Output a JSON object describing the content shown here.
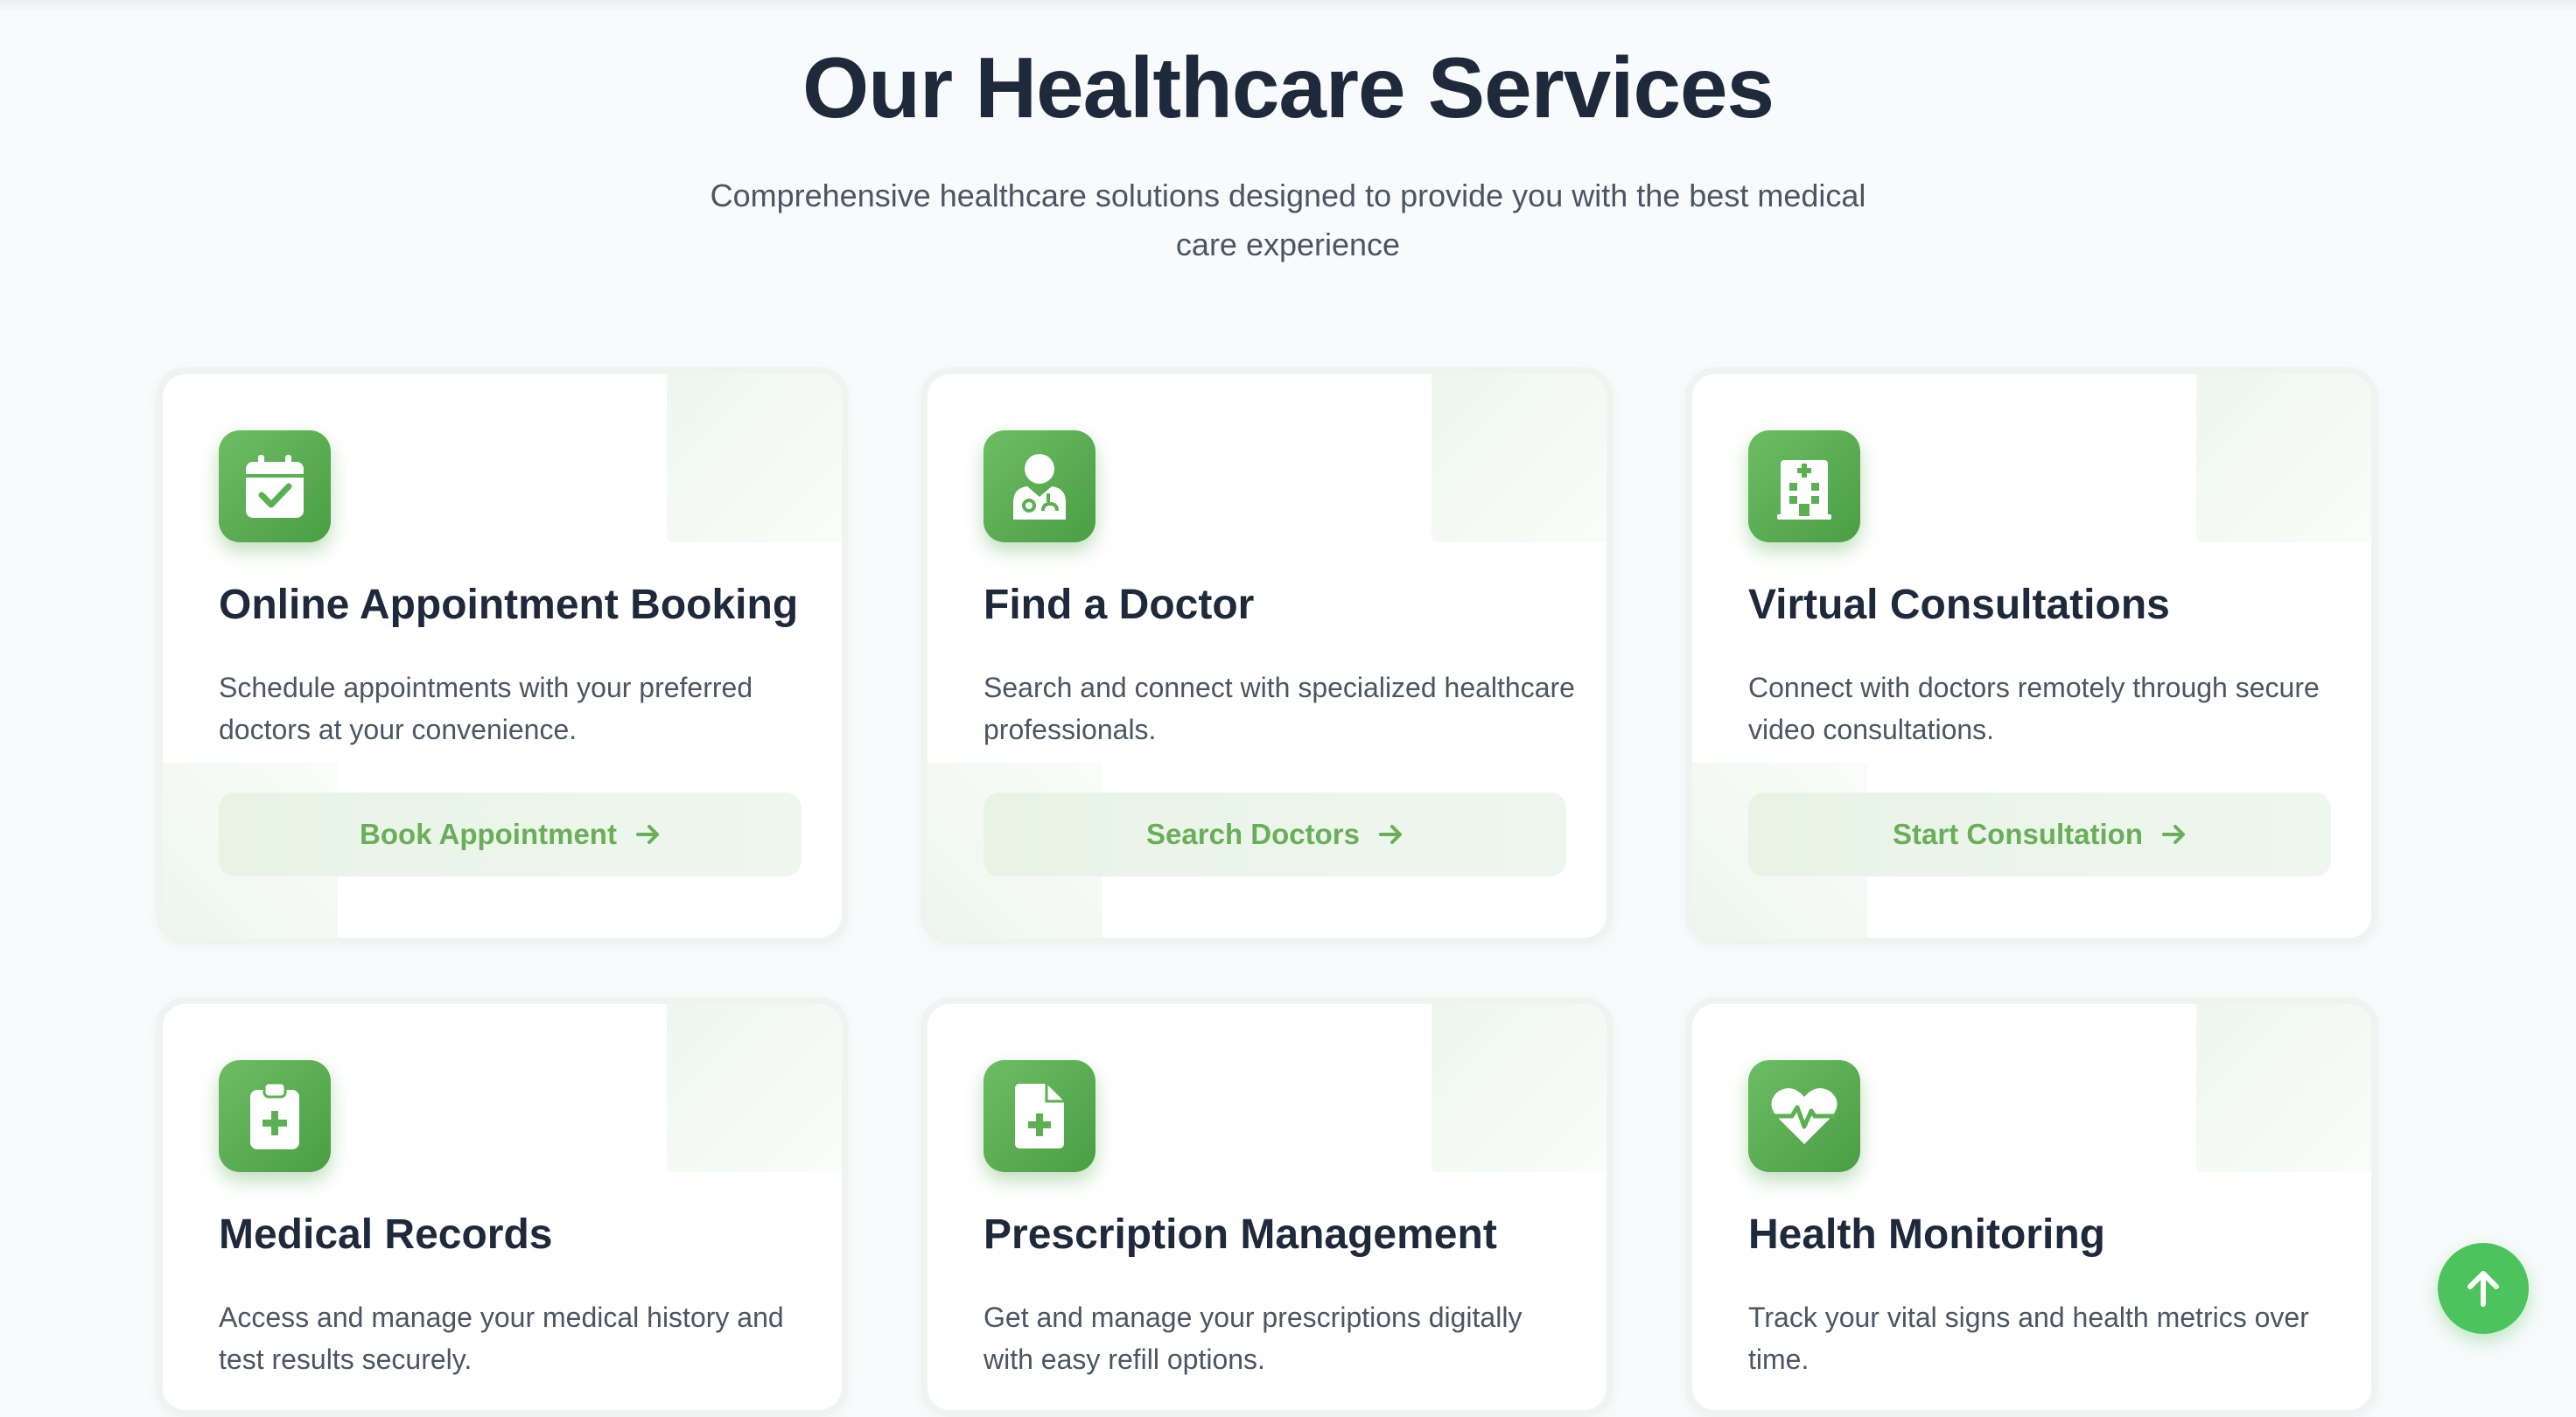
{
  "header": {
    "title": "Our Healthcare Services",
    "subtitle": "Comprehensive healthcare solutions designed to provide you with the best medical care experience"
  },
  "services": [
    {
      "title": "Online Appointment Booking",
      "description": "Schedule appointments with your preferred doctors at your convenience.",
      "button": "Book Appointment",
      "icon": "calendar-check-icon"
    },
    {
      "title": "Find a Doctor",
      "description": "Search and connect with specialized healthcare professionals.",
      "button": "Search Doctors",
      "icon": "doctor-icon"
    },
    {
      "title": "Virtual Consultations",
      "description": "Connect with doctors remotely through secure video consultations.",
      "button": "Start Consultation",
      "icon": "hospital-icon"
    },
    {
      "title": "Medical Records",
      "description": "Access and manage your medical history and test results securely.",
      "icon": "clipboard-medical-icon"
    },
    {
      "title": "Prescription Management",
      "description": "Get and manage your prescriptions digitally with easy refill options.",
      "icon": "prescription-file-icon"
    },
    {
      "title": "Health Monitoring",
      "description": "Track your vital signs and health metrics over time.",
      "icon": "heart-pulse-icon"
    }
  ],
  "colors": {
    "accent": "#4cae4c",
    "button_text": "#6aae5a",
    "scroll_button": "#4cc35c",
    "title": "#1e293b"
  },
  "scroll_top_icon": "arrow-up-icon"
}
